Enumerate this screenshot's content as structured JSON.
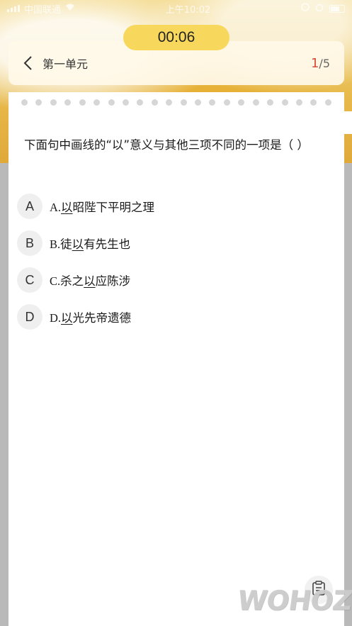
{
  "status_bar": {
    "carrier": "中国联通",
    "time": "上午10:02"
  },
  "timer": "00:06",
  "header": {
    "title": "第一单元",
    "progress_current": "1",
    "progress_total": "/5"
  },
  "question": {
    "text": "下面句中画线的“以”意义与其他三项不同的一项是（    ）"
  },
  "options": [
    {
      "letter": "A",
      "prefix": "A.",
      "before": "",
      "underlined": "以",
      "after": "昭陛下平明之理"
    },
    {
      "letter": "B",
      "prefix": "B.",
      "before": "徒",
      "underlined": "以",
      "after": "有先生也"
    },
    {
      "letter": "C",
      "prefix": "C.",
      "before": "杀之",
      "underlined": "以",
      "after": "应陈涉"
    },
    {
      "letter": "D",
      "prefix": "D.",
      "before": "",
      "underlined": "以",
      "after": "光先帝遗德"
    }
  ],
  "watermark": "WOHOZ",
  "icons": {
    "back": "chevron-left-icon",
    "answer_card": "answer-card-icon"
  },
  "colors": {
    "timer_bg": "#f7d85c",
    "progress_current": "#d94b3b",
    "side_bg": "#b9b9b9"
  }
}
